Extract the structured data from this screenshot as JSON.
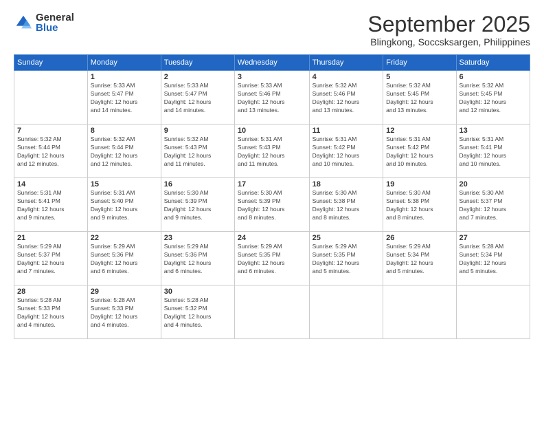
{
  "logo": {
    "general": "General",
    "blue": "Blue"
  },
  "header": {
    "month": "September 2025",
    "location": "Blingkong, Soccsksargen, Philippines"
  },
  "days_of_week": [
    "Sunday",
    "Monday",
    "Tuesday",
    "Wednesday",
    "Thursday",
    "Friday",
    "Saturday"
  ],
  "weeks": [
    [
      {
        "day": "",
        "info": ""
      },
      {
        "day": "1",
        "info": "Sunrise: 5:33 AM\nSunset: 5:47 PM\nDaylight: 12 hours\nand 14 minutes."
      },
      {
        "day": "2",
        "info": "Sunrise: 5:33 AM\nSunset: 5:47 PM\nDaylight: 12 hours\nand 14 minutes."
      },
      {
        "day": "3",
        "info": "Sunrise: 5:33 AM\nSunset: 5:46 PM\nDaylight: 12 hours\nand 13 minutes."
      },
      {
        "day": "4",
        "info": "Sunrise: 5:32 AM\nSunset: 5:46 PM\nDaylight: 12 hours\nand 13 minutes."
      },
      {
        "day": "5",
        "info": "Sunrise: 5:32 AM\nSunset: 5:45 PM\nDaylight: 12 hours\nand 13 minutes."
      },
      {
        "day": "6",
        "info": "Sunrise: 5:32 AM\nSunset: 5:45 PM\nDaylight: 12 hours\nand 12 minutes."
      }
    ],
    [
      {
        "day": "7",
        "info": "Sunrise: 5:32 AM\nSunset: 5:44 PM\nDaylight: 12 hours\nand 12 minutes."
      },
      {
        "day": "8",
        "info": "Sunrise: 5:32 AM\nSunset: 5:44 PM\nDaylight: 12 hours\nand 12 minutes."
      },
      {
        "day": "9",
        "info": "Sunrise: 5:32 AM\nSunset: 5:43 PM\nDaylight: 12 hours\nand 11 minutes."
      },
      {
        "day": "10",
        "info": "Sunrise: 5:31 AM\nSunset: 5:43 PM\nDaylight: 12 hours\nand 11 minutes."
      },
      {
        "day": "11",
        "info": "Sunrise: 5:31 AM\nSunset: 5:42 PM\nDaylight: 12 hours\nand 10 minutes."
      },
      {
        "day": "12",
        "info": "Sunrise: 5:31 AM\nSunset: 5:42 PM\nDaylight: 12 hours\nand 10 minutes."
      },
      {
        "day": "13",
        "info": "Sunrise: 5:31 AM\nSunset: 5:41 PM\nDaylight: 12 hours\nand 10 minutes."
      }
    ],
    [
      {
        "day": "14",
        "info": "Sunrise: 5:31 AM\nSunset: 5:41 PM\nDaylight: 12 hours\nand 9 minutes."
      },
      {
        "day": "15",
        "info": "Sunrise: 5:31 AM\nSunset: 5:40 PM\nDaylight: 12 hours\nand 9 minutes."
      },
      {
        "day": "16",
        "info": "Sunrise: 5:30 AM\nSunset: 5:39 PM\nDaylight: 12 hours\nand 9 minutes."
      },
      {
        "day": "17",
        "info": "Sunrise: 5:30 AM\nSunset: 5:39 PM\nDaylight: 12 hours\nand 8 minutes."
      },
      {
        "day": "18",
        "info": "Sunrise: 5:30 AM\nSunset: 5:38 PM\nDaylight: 12 hours\nand 8 minutes."
      },
      {
        "day": "19",
        "info": "Sunrise: 5:30 AM\nSunset: 5:38 PM\nDaylight: 12 hours\nand 8 minutes."
      },
      {
        "day": "20",
        "info": "Sunrise: 5:30 AM\nSunset: 5:37 PM\nDaylight: 12 hours\nand 7 minutes."
      }
    ],
    [
      {
        "day": "21",
        "info": "Sunrise: 5:29 AM\nSunset: 5:37 PM\nDaylight: 12 hours\nand 7 minutes."
      },
      {
        "day": "22",
        "info": "Sunrise: 5:29 AM\nSunset: 5:36 PM\nDaylight: 12 hours\nand 6 minutes."
      },
      {
        "day": "23",
        "info": "Sunrise: 5:29 AM\nSunset: 5:36 PM\nDaylight: 12 hours\nand 6 minutes."
      },
      {
        "day": "24",
        "info": "Sunrise: 5:29 AM\nSunset: 5:35 PM\nDaylight: 12 hours\nand 6 minutes."
      },
      {
        "day": "25",
        "info": "Sunrise: 5:29 AM\nSunset: 5:35 PM\nDaylight: 12 hours\nand 5 minutes."
      },
      {
        "day": "26",
        "info": "Sunrise: 5:29 AM\nSunset: 5:34 PM\nDaylight: 12 hours\nand 5 minutes."
      },
      {
        "day": "27",
        "info": "Sunrise: 5:28 AM\nSunset: 5:34 PM\nDaylight: 12 hours\nand 5 minutes."
      }
    ],
    [
      {
        "day": "28",
        "info": "Sunrise: 5:28 AM\nSunset: 5:33 PM\nDaylight: 12 hours\nand 4 minutes."
      },
      {
        "day": "29",
        "info": "Sunrise: 5:28 AM\nSunset: 5:33 PM\nDaylight: 12 hours\nand 4 minutes."
      },
      {
        "day": "30",
        "info": "Sunrise: 5:28 AM\nSunset: 5:32 PM\nDaylight: 12 hours\nand 4 minutes."
      },
      {
        "day": "",
        "info": ""
      },
      {
        "day": "",
        "info": ""
      },
      {
        "day": "",
        "info": ""
      },
      {
        "day": "",
        "info": ""
      }
    ]
  ]
}
